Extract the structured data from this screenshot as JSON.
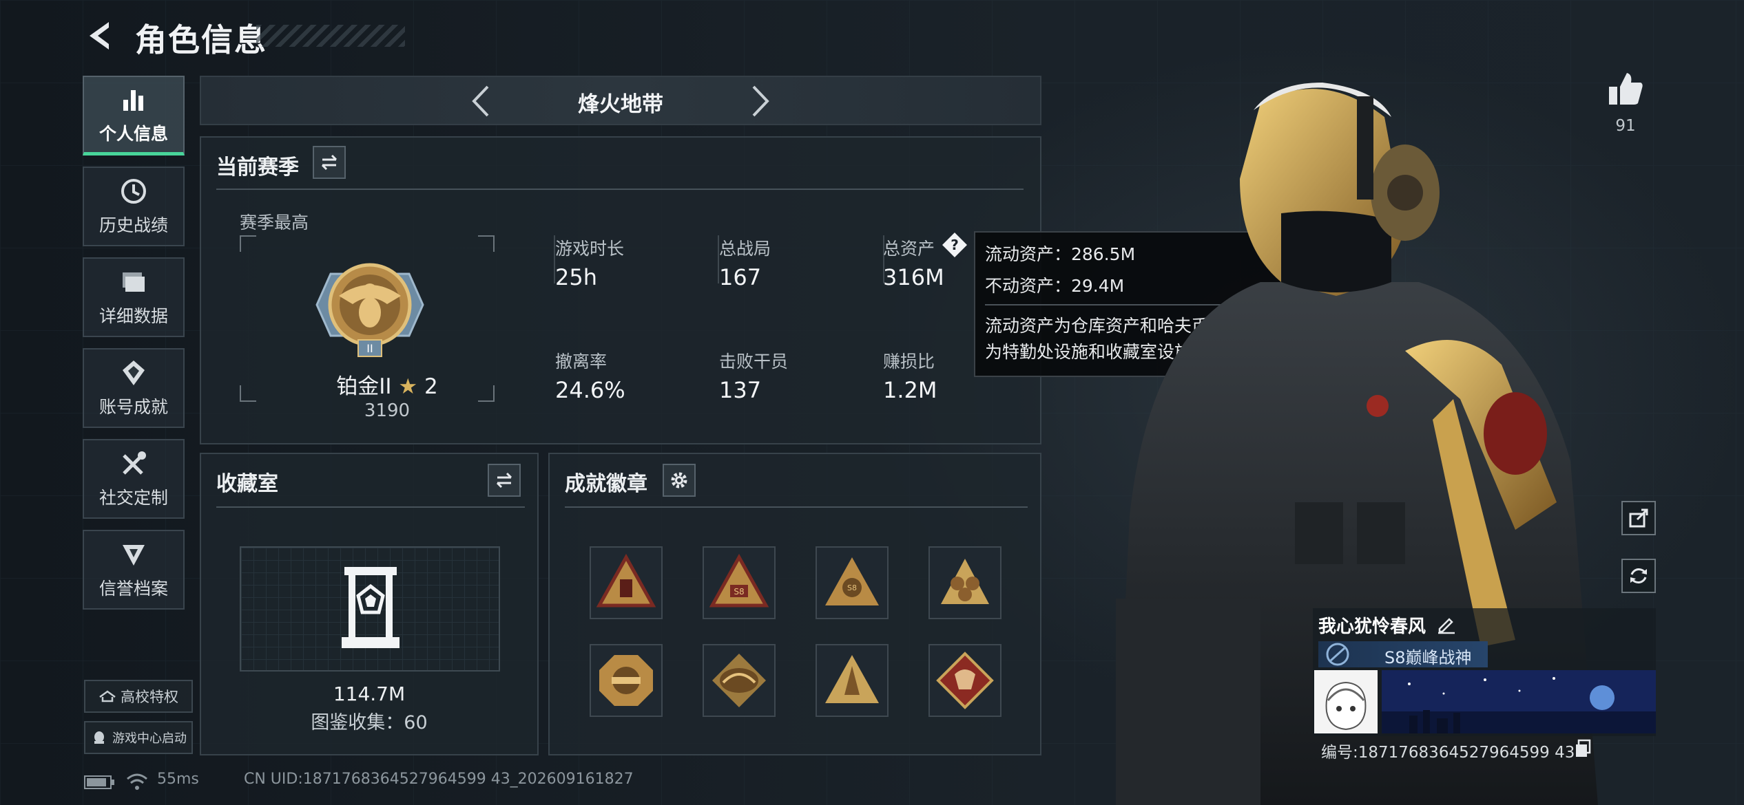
{
  "header": {
    "title": "角色信息",
    "back_icon": "back-arrow-icon"
  },
  "sidebar": {
    "items": [
      {
        "label": "个人信息",
        "icon": "bar-chart-icon",
        "active": true
      },
      {
        "label": "历史战绩",
        "icon": "clock-icon",
        "active": false
      },
      {
        "label": "详细数据",
        "icon": "folder-icon",
        "active": false
      },
      {
        "label": "账号成就",
        "icon": "medal-icon",
        "active": false
      },
      {
        "label": "社交定制",
        "icon": "tools-icon",
        "active": false
      },
      {
        "label": "信誉档案",
        "icon": "credit-icon",
        "active": false
      }
    ],
    "campus_label": "高校特权",
    "launch_label": "游戏中心启动"
  },
  "mode": {
    "title": "烽火地带"
  },
  "season": {
    "section_title": "当前赛季",
    "best_label": "赛季最高",
    "rank_name": "铂金II",
    "rank_stars": "2",
    "rank_score": "3190",
    "stats": [
      {
        "label": "游戏时长",
        "value": "25h"
      },
      {
        "label": "总战局",
        "value": "167"
      },
      {
        "label": "总资产",
        "value": "316M"
      },
      {
        "label": "撤离率",
        "value": "24.6%"
      },
      {
        "label": "击败干员",
        "value": "137"
      },
      {
        "label": "赚损比",
        "value": "1.2M"
      }
    ]
  },
  "tooltip": {
    "liquid": "流动资产：286.5M",
    "fixed": "不动资产：29.4M",
    "desc_line1": "流动资产为仓库资产和哈夫币，不动资产",
    "desc_line2": "为特勤处设施和收藏室设施"
  },
  "collection": {
    "section_title": "收藏室",
    "value": "114.7M",
    "count_label": "图鉴收集：60"
  },
  "badges": {
    "section_title": "成就徽章"
  },
  "status": {
    "ping": "55ms",
    "uid_line": "CN UID:1871768364527964599 43_202609161827"
  },
  "profile": {
    "likes": "91",
    "name": "我心犹怜春风",
    "title": "S8巅峰战神",
    "number_line": "编号:1871768364527964599 43"
  },
  "colors": {
    "accent_green": "#48d59a",
    "tooltip_bg": "#0a0c0e",
    "badge_gold": "#c9a45a",
    "badge_red": "#8b2a22"
  }
}
